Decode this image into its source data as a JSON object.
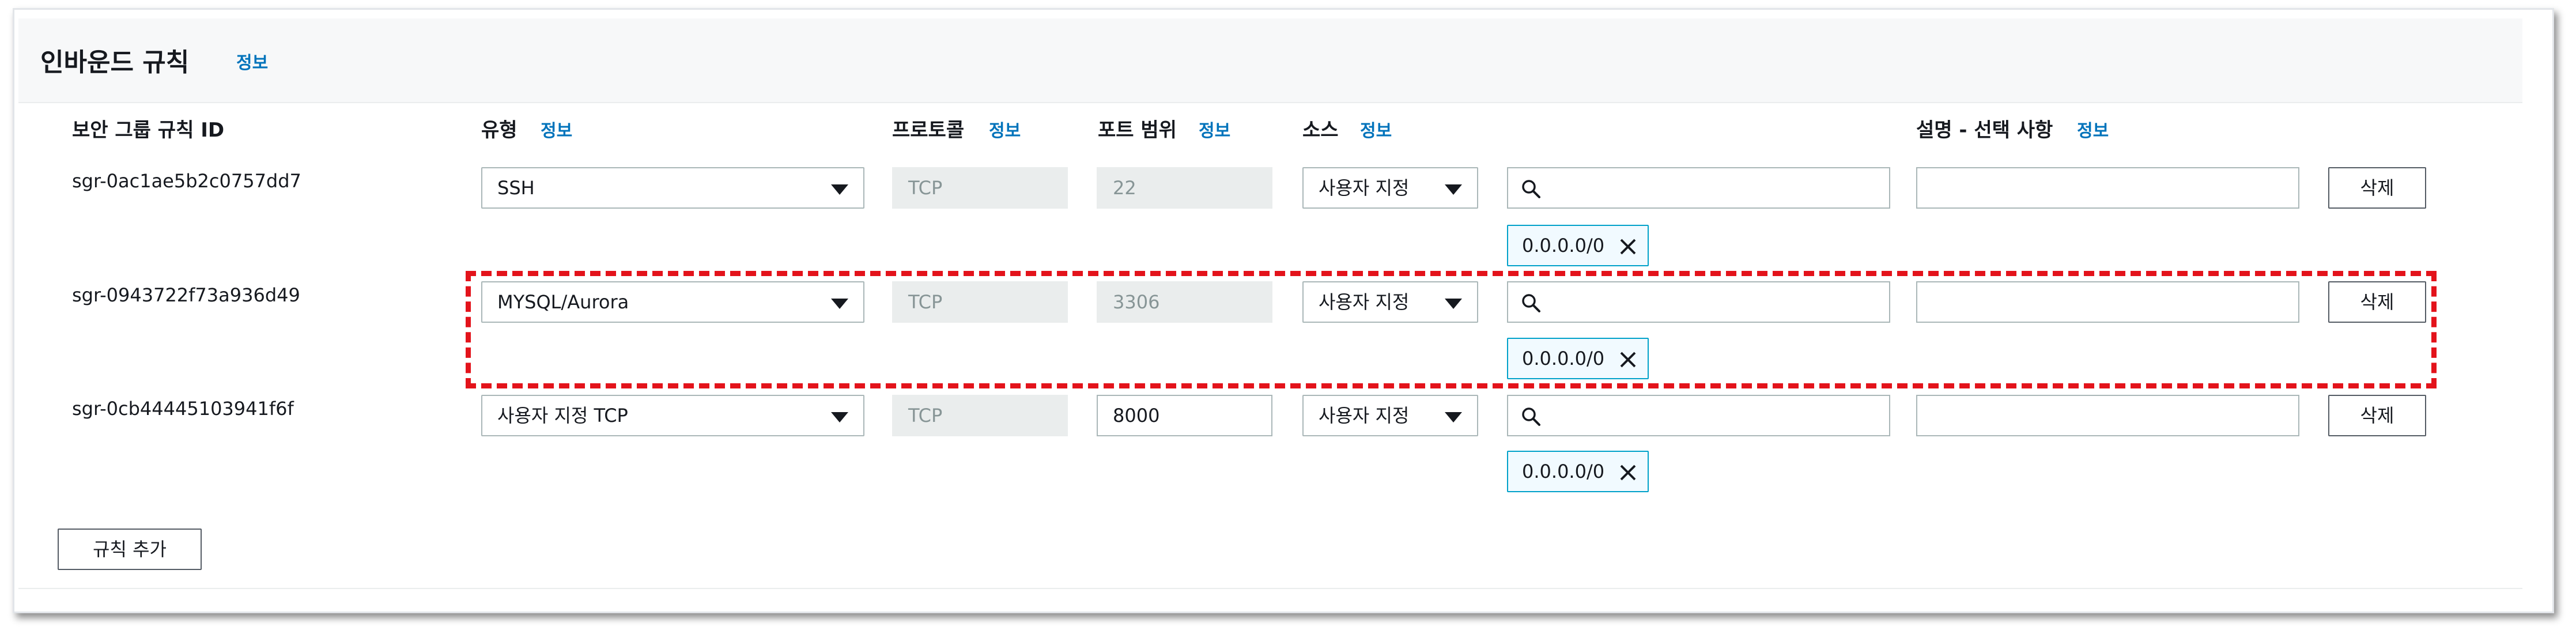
{
  "panel": {
    "title": "인바운드 규칙",
    "info_label": "정보"
  },
  "columns": {
    "rule_id": "보안 그룹 규칙 ID",
    "type": "유형",
    "protocol": "프로토콜",
    "port_range": "포트 범위",
    "source": "소스",
    "description": "설명 - 선택 사항",
    "info_label": "정보"
  },
  "rules": [
    {
      "id": "sgr-0ac1ae5b2c0757dd7",
      "type": "SSH",
      "protocol": "TCP",
      "port": "22",
      "source_type": "사용자 지정",
      "search_value": "",
      "cidr": "0.0.0.0/0",
      "description": "",
      "delete_label": "삭제"
    },
    {
      "id": "sgr-0943722f73a936d49",
      "type": "MYSQL/Aurora",
      "protocol": "TCP",
      "port": "3306",
      "source_type": "사용자 지정",
      "search_value": "",
      "cidr": "0.0.0.0/0",
      "description": "",
      "delete_label": "삭제"
    },
    {
      "id": "sgr-0cb44445103941f6f",
      "type": "사용자 지정 TCP",
      "protocol": "TCP",
      "port": "8000",
      "source_type": "사용자 지정",
      "search_value": "",
      "cidr": "0.0.0.0/0",
      "description": "",
      "delete_label": "삭제"
    }
  ],
  "actions": {
    "add_rule_label": "규칙 추가"
  },
  "colors": {
    "link": "#0073bb",
    "highlight": "#e3131b",
    "token_border": "#00a1c9"
  }
}
